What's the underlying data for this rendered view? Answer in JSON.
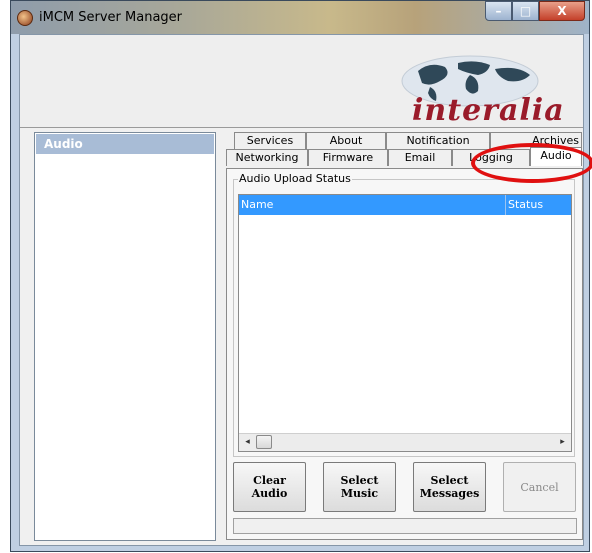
{
  "window": {
    "title": "iMCM Server Manager"
  },
  "controls": {
    "minimize": "–",
    "maximize": "□",
    "close": "X"
  },
  "banner": {
    "brand": "interalia"
  },
  "sidebar": {
    "items": [
      {
        "label": "Audio"
      }
    ]
  },
  "tabs": {
    "back_row": [
      "Services",
      "About",
      "Notification",
      "Archives"
    ],
    "front_row": [
      "Networking",
      "Firmware",
      "Email",
      "Logging",
      "Audio"
    ],
    "active": "Audio"
  },
  "audio": {
    "group_label": "Audio Upload Status",
    "columns": [
      "Name",
      "Status"
    ],
    "rows": []
  },
  "scroll": {
    "left_arrow": "◂",
    "right_arrow": "▸"
  },
  "buttons": {
    "clear_audio": "Clear Audio",
    "select_music": "Select\nMusic",
    "select_messages": "Select\nMessages",
    "cancel": "Cancel"
  },
  "colors": {
    "accent": "#3399ff",
    "annotation": "#e01010",
    "brand": "#9a1b2a"
  }
}
